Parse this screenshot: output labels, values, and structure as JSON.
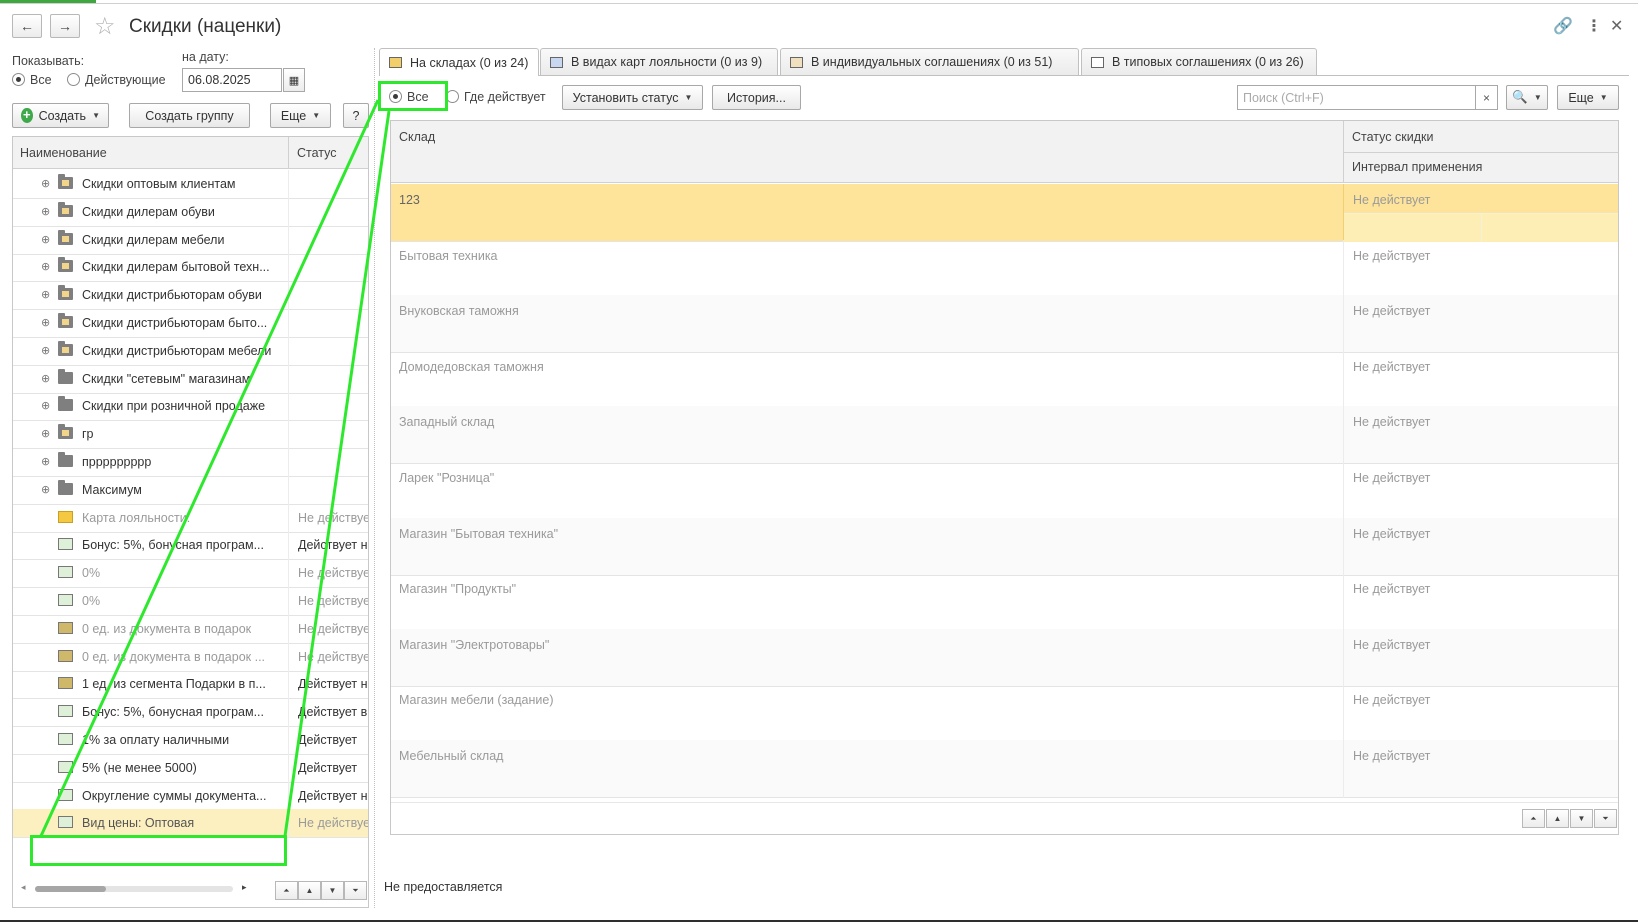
{
  "window": {
    "title": "Скидки (наценки)"
  },
  "header": {
    "back_icon": "←",
    "forward_icon": "→"
  },
  "filter": {
    "show_label": "Показывать:",
    "date_label": "на дату:",
    "radio_all": "Все",
    "radio_active": "Действующие",
    "date_value": "06.08.2025"
  },
  "left_toolbar": {
    "create": "Создать",
    "create_group": "Создать группу",
    "more": "Еще",
    "help": "?"
  },
  "left_table": {
    "columns": [
      "Наименование",
      "Статус"
    ],
    "rows": [
      {
        "name": "Скидки оптовым клиентам",
        "status": ""
      },
      {
        "name": "Скидки дилерам обуви",
        "status": ""
      },
      {
        "name": "Скидки дилерам мебели",
        "status": ""
      },
      {
        "name": "Скидки дилерам бытовой техн...",
        "status": ""
      },
      {
        "name": "Скидки дистрибьюторам обуви",
        "status": ""
      },
      {
        "name": "Скидки дистрибьюторам быто...",
        "status": ""
      },
      {
        "name": "Скидки дистрибьюторам мебели",
        "status": ""
      },
      {
        "name": "Скидки \"сетевым\" магазинам",
        "status": ""
      },
      {
        "name": "Скидки при розничной продаже",
        "status": ""
      },
      {
        "name": "гр",
        "status": ""
      },
      {
        "name": "пррррррррр",
        "status": ""
      },
      {
        "name": "Максимум",
        "status": ""
      },
      {
        "name": "Карта лояльности:",
        "status": "Не действует"
      },
      {
        "name": "Бонус: 5%, бонусная програм...",
        "status": "Действует н"
      },
      {
        "name": "0%",
        "status": "Не действует"
      },
      {
        "name": "0%",
        "status": "Не действует"
      },
      {
        "name": "0 ед. из документа в подарок",
        "status": "Не действует"
      },
      {
        "name": "0 ед. из документа в подарок ...",
        "status": "Не действует"
      },
      {
        "name": "1 ед. из сегмента Подарки в п...",
        "status": "Действует н"
      },
      {
        "name": "Бонус: 5%, бонусная програм...",
        "status": "Действует в"
      },
      {
        "name": "1% за оплату наличными",
        "status": "Действует"
      },
      {
        "name": "5% (не менее 5000)",
        "status": "Действует"
      },
      {
        "name": "Округление суммы документа...",
        "status": "Действует н"
      },
      {
        "name": "Вид цены: Оптовая",
        "status": "Не действует"
      }
    ]
  },
  "tabs": [
    {
      "label": "На складах (0 из 24)"
    },
    {
      "label": "В видах карт лояльности (0 из 9)"
    },
    {
      "label": "В индивидуальных соглашениях (0 из 51)"
    },
    {
      "label": "В типовых соглашениях (0 из 26)"
    }
  ],
  "right_toolbar": {
    "radio_all": "Все",
    "radio_where": "Где действует",
    "set_status": "Установить статус",
    "history": "История...",
    "search_placeholder": "Поиск (Ctrl+F)",
    "clear": "×",
    "more": "Еще"
  },
  "right_table": {
    "columns": {
      "warehouse": "Склад",
      "status": "Статус скидки",
      "interval": "Интервал применения"
    },
    "rows": [
      {
        "warehouse": "123",
        "status": "Не действует"
      },
      {
        "warehouse": "Бытовая техника",
        "status": "Не действует"
      },
      {
        "warehouse": "Внуковская таможня",
        "status": "Не действует"
      },
      {
        "warehouse": "Домодедовская таможня",
        "status": "Не действует"
      },
      {
        "warehouse": "Западный склад",
        "status": "Не действует"
      },
      {
        "warehouse": "Ларек \"Розница\"",
        "status": "Не действует"
      },
      {
        "warehouse": "Магазин \"Бытовая техника\"",
        "status": "Не действует"
      },
      {
        "warehouse": "Магазин \"Продукты\"",
        "status": "Не действует"
      },
      {
        "warehouse": "Магазин \"Электротовары\"",
        "status": "Не действует"
      },
      {
        "warehouse": "Магазин мебели (задание)",
        "status": "Не действует"
      },
      {
        "warehouse": "Мебельный склад",
        "status": "Не действует"
      }
    ]
  },
  "footer": {
    "note": "Не предоставляется"
  },
  "colors": {
    "selection": "#fde49a",
    "annotation": "#2ee82e",
    "accent_green": "#3ea84a"
  }
}
